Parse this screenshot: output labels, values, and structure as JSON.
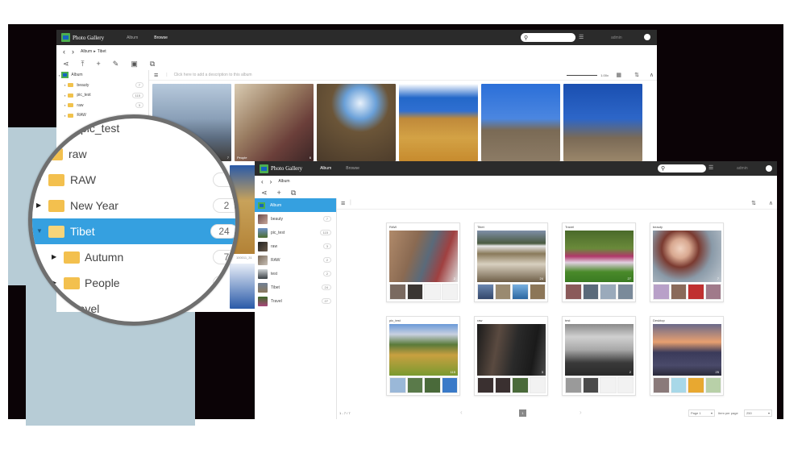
{
  "app": {
    "title": "Photo Gallery",
    "user": "admin"
  },
  "window_back": {
    "nav_tabs": [
      {
        "label": "Album",
        "active": false
      },
      {
        "label": "Browse",
        "active": true
      }
    ],
    "breadcrumb": [
      "Album",
      "Tibet"
    ],
    "breadcrumb_sep": "▸",
    "toolbar_icons": [
      "share-icon",
      "upload-icon",
      "add-icon",
      "edit-icon",
      "slideshow-icon",
      "copy-icon"
    ],
    "description_placeholder": "Click here to add a description to this album",
    "zoom_level": "1.00x",
    "tree": [
      {
        "label": "Album",
        "type": "root"
      },
      {
        "label": "beauty",
        "count": "7"
      },
      {
        "label": "pic_test",
        "count": "115"
      },
      {
        "label": "raw",
        "count": "3"
      },
      {
        "label": "RAW",
        "count": ""
      }
    ],
    "photos": [
      {
        "name": "mountain",
        "badge": "7",
        "label": ""
      },
      {
        "name": "people-portrait",
        "badge": "6",
        "label": "People"
      },
      {
        "name": "canyon-cave",
        "badge": "",
        "label": ""
      },
      {
        "name": "desert-plain",
        "badge": "",
        "label": ""
      },
      {
        "name": "group-children",
        "badge": "",
        "label": ""
      },
      {
        "name": "road-cars",
        "badge": "",
        "label": ""
      }
    ],
    "partial_caption": "100011_31"
  },
  "magnifier": {
    "items": [
      {
        "label": "pic_test",
        "partial": true,
        "count": ""
      },
      {
        "label": "raw",
        "count": ""
      },
      {
        "label": "RAW",
        "count": "",
        "expandable": true
      },
      {
        "label": "New Year",
        "count": "2",
        "expandable": true
      },
      {
        "label": "Tibet",
        "count": "24",
        "expandable": true,
        "expanded": true,
        "selected": true
      },
      {
        "label": "Autumn",
        "count": "7",
        "expandable": true,
        "child": true
      },
      {
        "label": "People",
        "count": "",
        "expandable": true,
        "child": true
      },
      {
        "label": "Travel",
        "count": ""
      }
    ]
  },
  "window_front": {
    "nav_tabs": [
      {
        "label": "Album",
        "active": true
      },
      {
        "label": "Browse",
        "active": false
      }
    ],
    "breadcrumb": [
      "Album"
    ],
    "toolbar_icons": [
      "share-icon",
      "add-icon",
      "copy-icon"
    ],
    "tree": [
      {
        "label": "Album",
        "count": "",
        "selected": true
      },
      {
        "label": "beauty",
        "count": "7"
      },
      {
        "label": "pic_test",
        "count": "115"
      },
      {
        "label": "raw",
        "count": "3"
      },
      {
        "label": "RAW",
        "count": "2"
      },
      {
        "label": "test",
        "count": "2"
      },
      {
        "label": "Tibet",
        "count": "24"
      },
      {
        "label": "Travel",
        "count": "27"
      }
    ],
    "albums": [
      {
        "title": "RAW",
        "count": "2",
        "thumbs_filled": 2
      },
      {
        "title": "Tibet",
        "count": "24",
        "thumbs_filled": 4
      },
      {
        "title": "Travel",
        "count": "27",
        "thumbs_filled": 4
      },
      {
        "title": "beauty",
        "count": "7",
        "thumbs_filled": 4
      },
      {
        "title": "pic_test",
        "count": "115",
        "thumbs_filled": 4
      },
      {
        "title": "raw",
        "count": "3",
        "thumbs_filled": 3
      },
      {
        "title": "test",
        "count": "2",
        "thumbs_filled": 2
      },
      {
        "title": "Desktop",
        "count": "25",
        "thumbs_filled": 4
      }
    ],
    "footer": {
      "range": "1 - 7 / 7",
      "current_page": "1",
      "page_select": "Page 1",
      "items_per_page_label": "Item per page",
      "items_per_page": "250"
    }
  },
  "colors": {
    "accent": "#35a0e0",
    "topbar": "#2b2b2b",
    "folder": "#f3c04e",
    "backdrop": "#0b0306",
    "panel_blue": "#b7ccd6"
  }
}
